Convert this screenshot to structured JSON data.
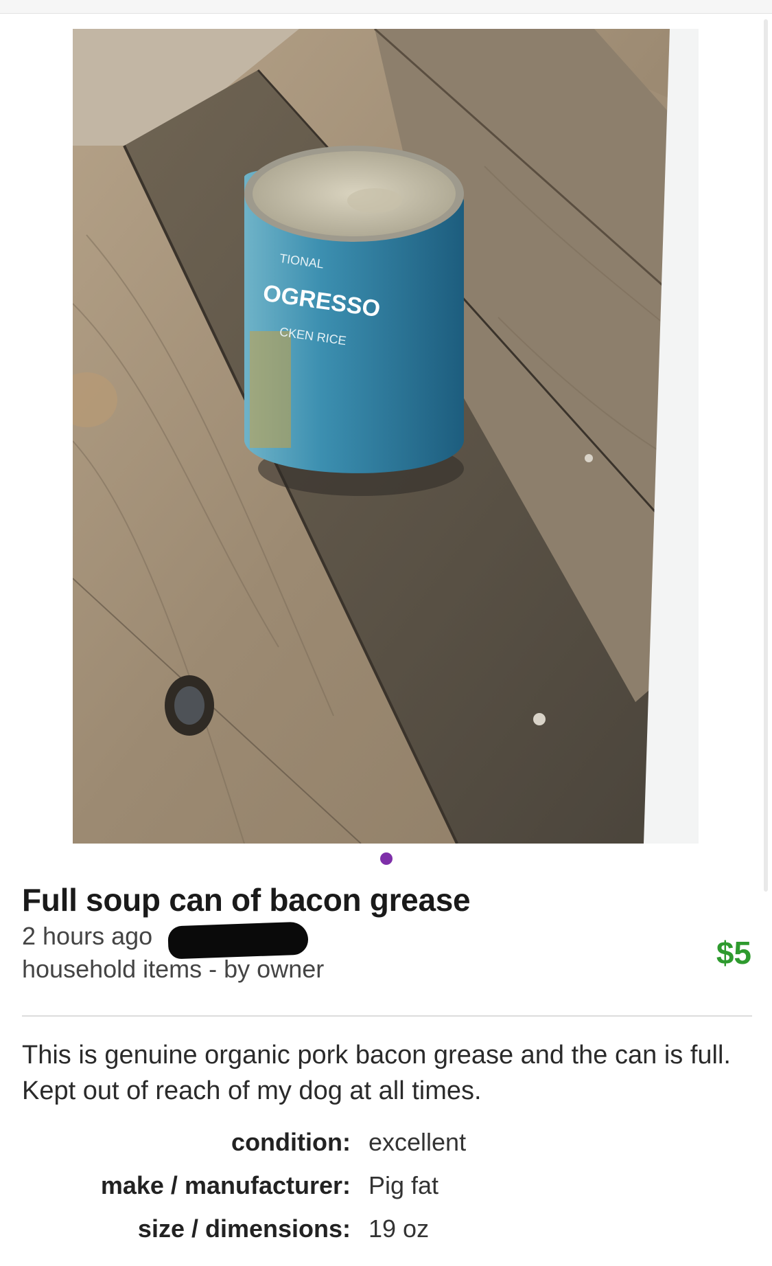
{
  "listing": {
    "title": "Full soup can of bacon grease",
    "posted": "2 hours ago",
    "category_line": "household items - by owner",
    "price": "$5",
    "description": "This is genuine organic pork bacon grease and the can is full. Kept out of reach of my dog at all times.",
    "attributes": [
      {
        "label": "condition:",
        "value": "excellent"
      },
      {
        "label": "make / manufacturer:",
        "value": "Pig fat"
      },
      {
        "label": "size / dimensions:",
        "value": "19 oz"
      }
    ]
  },
  "photo": {
    "can_brand_text": "OGRESSO",
    "can_line1": "TIONAL",
    "can_line2": "CKEN RICE"
  },
  "colors": {
    "price": "#2e9a2e",
    "indicator": "#7e2fa9"
  }
}
